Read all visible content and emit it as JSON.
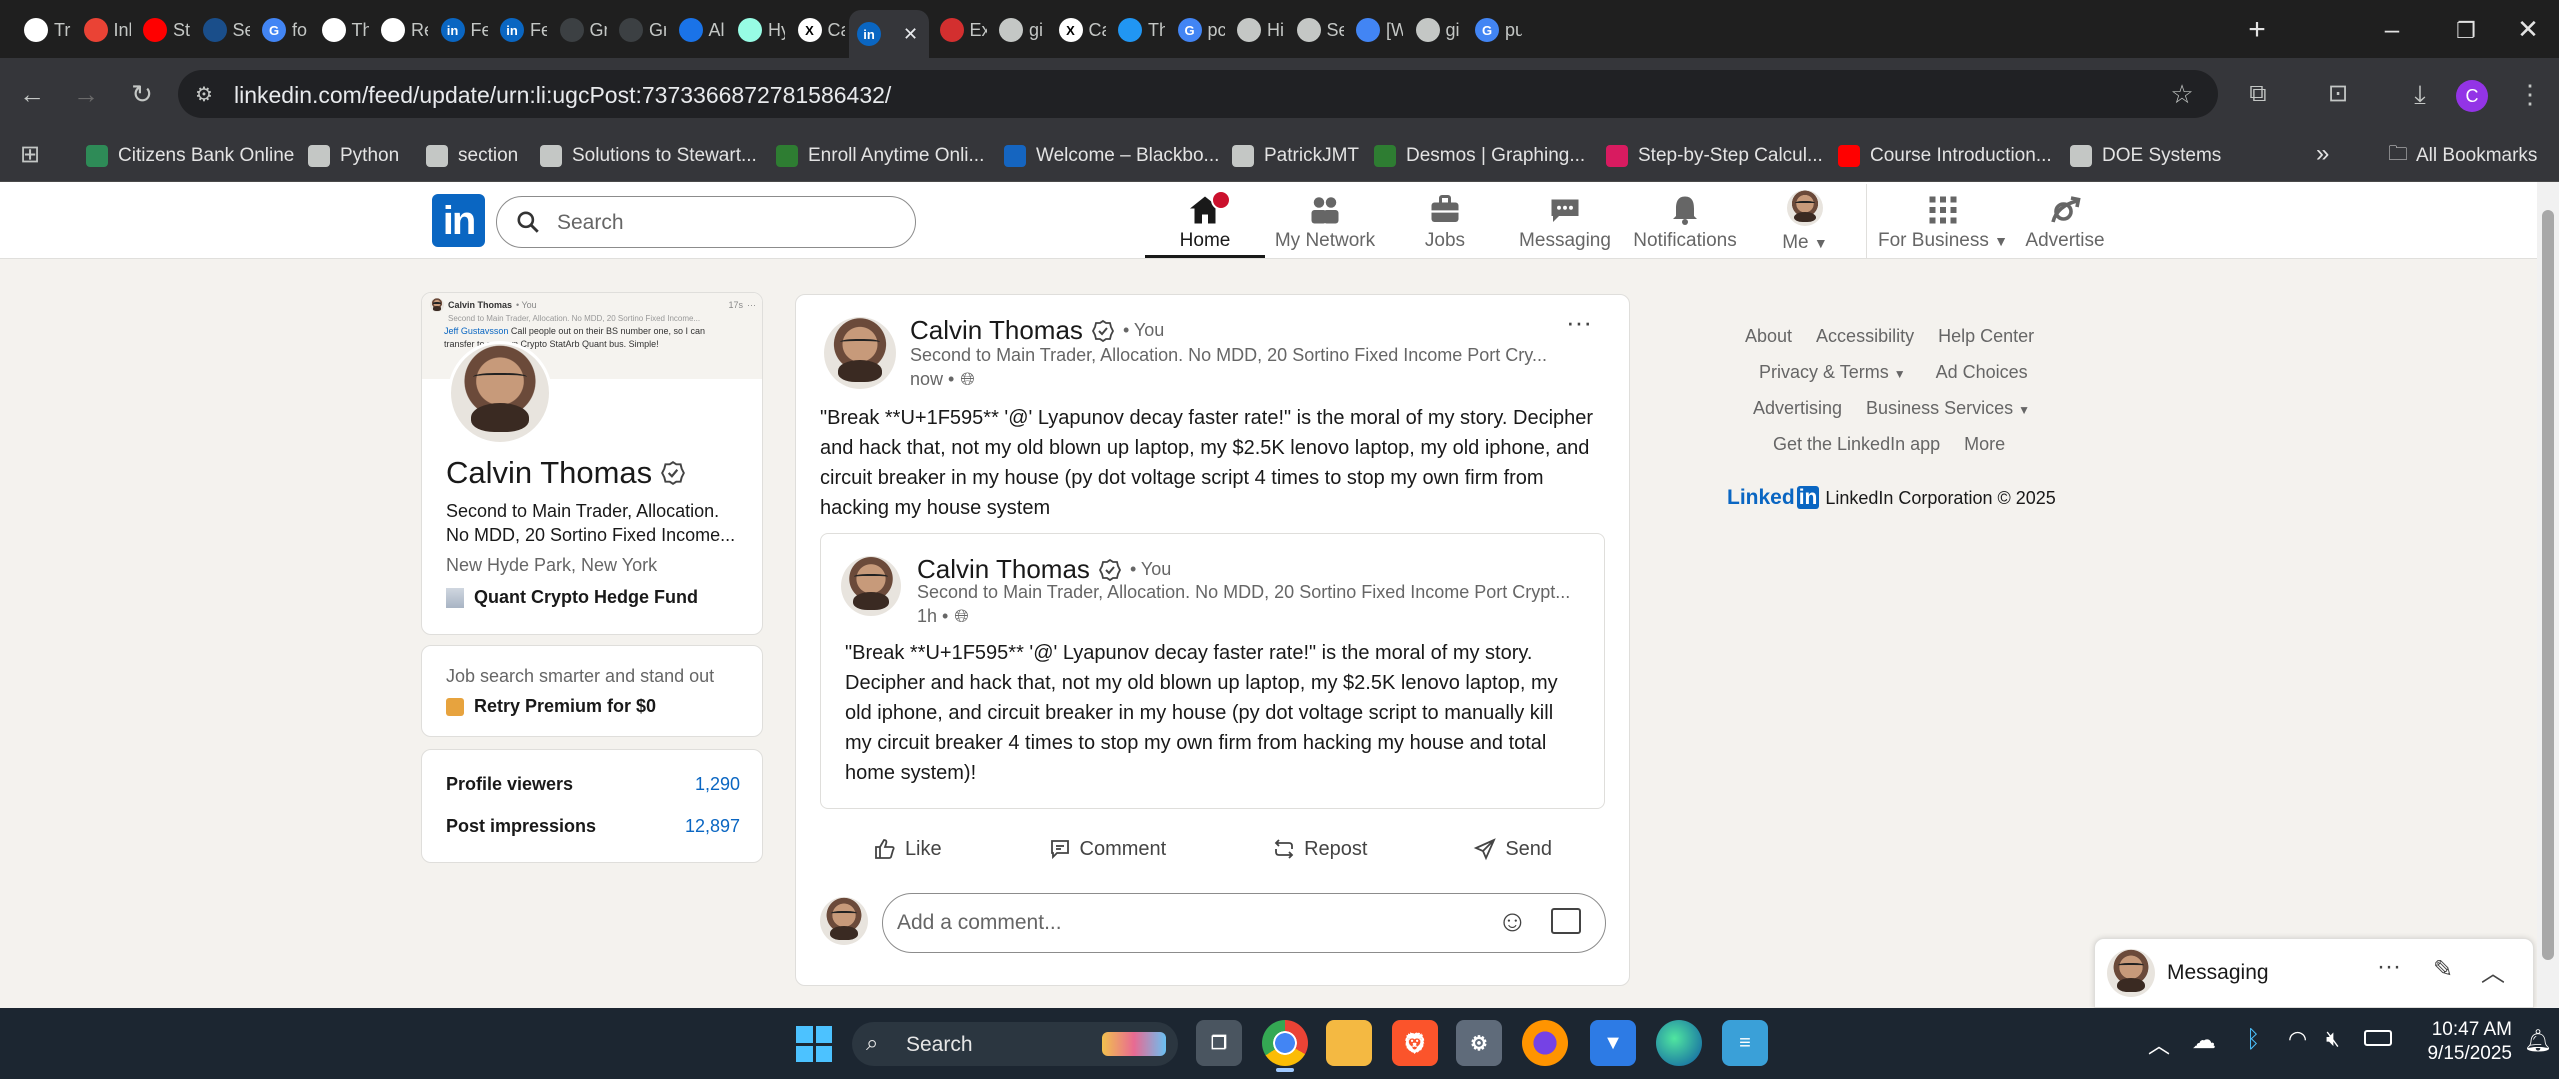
{
  "browser": {
    "tabs": [
      {
        "label": "Tra",
        "icon": "github-icon",
        "color": "#ffffff"
      },
      {
        "label": "Inl",
        "icon": "gmail-icon",
        "color": "#ea4335"
      },
      {
        "label": "Stu",
        "icon": "youtube-icon",
        "color": "#ff0000"
      },
      {
        "label": "Se",
        "icon": "ssrn-icon",
        "color": "#1a4e8a"
      },
      {
        "label": "fo",
        "icon": "google-icon",
        "color": "#4285f4"
      },
      {
        "label": "Th",
        "icon": "researchgate-icon",
        "color": "#ffffff"
      },
      {
        "label": "Re",
        "icon": "researchgate-icon",
        "color": "#ffffff"
      },
      {
        "label": "Fe",
        "icon": "linkedin-icon",
        "color": "#0a66c2"
      },
      {
        "label": "Fe",
        "icon": "linkedin-icon",
        "color": "#0a66c2"
      },
      {
        "label": "Gr",
        "icon": "grok-icon",
        "color": "#3c4043"
      },
      {
        "label": "Gr",
        "icon": "grok-icon",
        "color": "#3c4043"
      },
      {
        "label": "Al",
        "icon": "alpha-icon",
        "color": "#1a73e8"
      },
      {
        "label": "Hy",
        "icon": "hyperliquid-icon",
        "color": "#97fce4"
      },
      {
        "label": "Ca",
        "icon": "x-icon",
        "color": "#ffffff"
      },
      {
        "label": "",
        "icon": "linkedin-icon",
        "color": "#0a66c2",
        "active": true
      },
      {
        "label": "Ex",
        "icon": "cme-icon",
        "color": "#d32f2f"
      },
      {
        "label": "gi",
        "icon": "globe-icon",
        "color": "#c4c7c5"
      },
      {
        "label": "Ca",
        "icon": "x-icon",
        "color": "#ffffff"
      },
      {
        "label": "Th",
        "icon": "tradingview-icon",
        "color": "#2196f3"
      },
      {
        "label": "pc",
        "icon": "google-icon",
        "color": "#4285f4"
      },
      {
        "label": "Hi",
        "icon": "history-icon",
        "color": "#c4c7c5"
      },
      {
        "label": "Se",
        "icon": "gear-icon",
        "color": "#c4c7c5"
      },
      {
        "label": "[W",
        "icon": "doc-icon",
        "color": "#4285f4"
      },
      {
        "label": "gi",
        "icon": "globe-icon",
        "color": "#c4c7c5"
      },
      {
        "label": "pu",
        "icon": "google-icon",
        "color": "#4285f4"
      }
    ],
    "url": "linkedin.com/feed/update/urn:li:ugcPost:7373366872781586432/",
    "bookmarks": [
      {
        "label": "Citizens Bank Online",
        "icon": "citizens-icon",
        "color": "#2e8b57"
      },
      {
        "label": "Python",
        "icon": "folder-icon",
        "color": "#c4c7c5"
      },
      {
        "label": "section",
        "icon": "globe-icon",
        "color": "#c4c7c5"
      },
      {
        "label": "Solutions to Stewart...",
        "icon": "globe-icon",
        "color": "#c4c7c5"
      },
      {
        "label": "Enroll Anytime Onli...",
        "icon": "unf-icon",
        "color": "#2e7d32"
      },
      {
        "label": "Welcome – Blackbo...",
        "icon": "blackboard-icon",
        "color": "#1565c0"
      },
      {
        "label": "PatrickJMT",
        "icon": "globe-icon",
        "color": "#c4c7c5"
      },
      {
        "label": "Desmos | Graphing...",
        "icon": "desmos-icon",
        "color": "#2e7d32"
      },
      {
        "label": "Step-by-Step Calcul...",
        "icon": "symbolab-icon",
        "color": "#d81b60"
      },
      {
        "label": "Course Introduction...",
        "icon": "youtube-icon",
        "color": "#ff0000"
      },
      {
        "label": "DOE Systems",
        "icon": "shield-icon",
        "color": "#c4c7c5"
      }
    ],
    "all_bookmarks": "All Bookmarks",
    "profile_initial": "C"
  },
  "nav": {
    "search_placeholder": "Search",
    "items": [
      {
        "label": "Home",
        "badge": "",
        "active": true
      },
      {
        "label": "My Network"
      },
      {
        "label": "Jobs"
      },
      {
        "label": "Messaging"
      },
      {
        "label": "Notifications"
      },
      {
        "label": "Me"
      },
      {
        "label": "For Business"
      },
      {
        "label": "Advertise"
      }
    ]
  },
  "profile": {
    "name": "Calvin Thomas",
    "headline": "Second to Main Trader, Allocation. No MDD, 20 Sortino Fixed Income...",
    "location": "New Hyde Park, New York",
    "company": "Quant Crypto Hedge Fund",
    "banner_name": "Calvin Thomas",
    "banner_you": "• You",
    "banner_time": "17s",
    "banner_sub": "Second to Main Trader, Allocation. No MDD, 20 Sortino Fixed Income...",
    "banner_mention": "Jeff Gustavsson",
    "banner_text": "Call people out on their BS number one, so I can",
    "banner_text2": "transfer to my own Crypto StatArb Quant bus. Simple!",
    "premium_prompt": "Job search smarter and stand out",
    "premium_cta": "Retry Premium for $0",
    "stats": [
      {
        "label": "Profile viewers",
        "value": "1,290"
      },
      {
        "label": "Post impressions",
        "value": "12,897"
      }
    ]
  },
  "post": {
    "author": "Calvin Thomas",
    "you": "• You",
    "headline": "Second to Main Trader, Allocation. No MDD, 20 Sortino Fixed Income Port Cry...",
    "time": "now •",
    "body": "\"Break **U+1F595** '@' Lyapunov decay faster rate!\" is the moral of my story. Decipher and hack that, not my old blown up laptop, my $2.5K lenovo laptop, my old iphone, and circuit breaker in my house (py dot voltage script 4 times to stop my own firm from hacking my house system",
    "quoted": {
      "author": "Calvin Thomas",
      "you": "• You",
      "headline": "Second to Main Trader, Allocation. No MDD, 20 Sortino Fixed Income Port Crypt...",
      "time": "1h •",
      "body": "\"Break **U+1F595** '@' Lyapunov decay faster rate!\" is the moral of my story. Decipher and hack that, not my old blown up laptop, my $2.5K lenovo laptop, my old iphone, and circuit breaker in my house (py dot voltage script to manually kill my circuit breaker 4 times to stop my own firm from hacking my house and total home system)!"
    },
    "actions": [
      "Like",
      "Comment",
      "Repost",
      "Send"
    ],
    "comment_placeholder": "Add a comment..."
  },
  "footer_links": {
    "row1": [
      "About",
      "Accessibility",
      "Help Center"
    ],
    "row2": [
      "Privacy & Terms",
      "Ad Choices"
    ],
    "row3": [
      "Advertising",
      "Business Services"
    ],
    "row4": [
      "Get the LinkedIn app",
      "More"
    ],
    "brand": "Linked",
    "brand_in": "in",
    "copyright": "LinkedIn Corporation © 2025"
  },
  "messaging": {
    "label": "Messaging"
  },
  "taskbar": {
    "search_label": "Search",
    "time": "10:47 AM",
    "date": "9/15/2025"
  },
  "colors": {
    "linkedin_blue": "#0a66c2",
    "notification_red": "#cb112d",
    "premium_gold": "#f8c77e"
  }
}
